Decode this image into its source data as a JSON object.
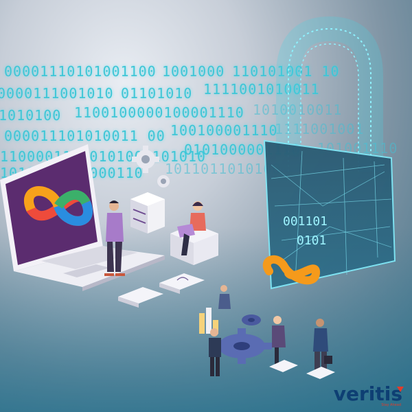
{
  "binary_rows": [
    "00001110101001100",
    "1001000",
    "110101001 10",
    "0000111001010",
    "01101010",
    "1111001010011",
    "1010100",
    "1100100000100001110",
    "1010010011",
    "000011101010011 00",
    "100100001110",
    "1111001001",
    "11000011110101001101010",
    "0101000001110",
    "101001110",
    "1010110010000110",
    "1011011010100"
  ],
  "lock_digits": [
    "001101",
    "0101"
  ],
  "logo": {
    "wordmark": "veritis",
    "tagline": "Stay Ahead"
  },
  "colors": {
    "cyan_glow": "#3fc6d6",
    "brand_blue": "#0e3f73",
    "brand_red": "#e23c2b",
    "laptop_purple": "#5b2c6f",
    "infinity_orange": "#f59a1b"
  }
}
